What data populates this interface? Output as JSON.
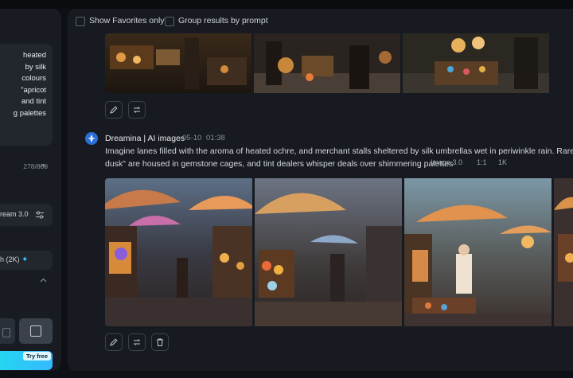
{
  "left_panel": {
    "prompt_lines": [
      "heated",
      "by silk",
      "colours",
      "\"apricot",
      "and tint",
      "g palettes"
    ],
    "char_count": "278/800",
    "model_label": "ream 3.0",
    "resolution_label": "h (2K)",
    "generate_badge": "Try free"
  },
  "filters": {
    "favorites_label": "Show Favorites only",
    "group_label": "Group results by prompt"
  },
  "result": {
    "author": "Dreamina | AI images",
    "date": "05-10",
    "time": "01:38",
    "prompt_line1": "Imagine lanes filled with the aroma of heated ochre, and merchant stalls sheltered by silk umbrellas wet in periwinkle rain. Rare colours such",
    "prompt_line2": "dusk\" are housed in gemstone cages, and tint dealers whisper deals over shimmering palettes",
    "tags": [
      "Image 3.0",
      "1:1",
      "1K"
    ]
  },
  "colors": {
    "accent": "#36c5f0",
    "panel_bg": "#171b21",
    "page_bg": "#0d1014"
  }
}
